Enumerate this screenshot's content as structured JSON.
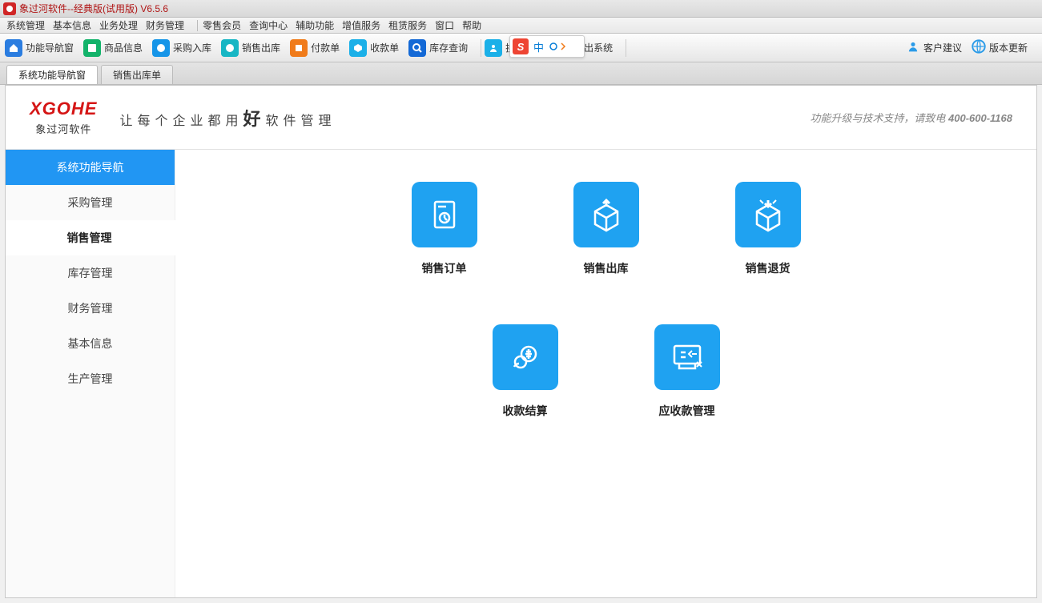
{
  "title": "象过河软件--经典版(试用版) V6.5.6",
  "menubar": [
    "系统管理",
    "基本信息",
    "业务处理",
    "财务管理",
    "零售会员",
    "查询中心",
    "辅助功能",
    "增值服务",
    "租赁服务",
    "窗口",
    "帮助"
  ],
  "toolbar": [
    {
      "label": "功能导航窗",
      "color": "#2b7de0"
    },
    {
      "label": "商品信息",
      "color": "#13b36a"
    },
    {
      "label": "采购入库",
      "color": "#1695e8"
    },
    {
      "label": "销售出库",
      "color": "#17b6c4"
    },
    {
      "label": "付款单",
      "color": "#f07b1a"
    },
    {
      "label": "收款单",
      "color": "#1bb0e8"
    },
    {
      "label": "库存查询",
      "color": "#1469d6"
    },
    {
      "label": "换操作员",
      "color": "#1bb0e8"
    },
    {
      "label": "退出系统",
      "color": "#e23a2e"
    }
  ],
  "toolbar_right": [
    {
      "label": "客户建议"
    },
    {
      "label": "版本更新"
    }
  ],
  "ime": {
    "zh": "中"
  },
  "tabs": [
    {
      "label": "系统功能导航窗",
      "active": true
    },
    {
      "label": "销售出库单",
      "active": false
    }
  ],
  "logo": {
    "big": "XGOHE",
    "small": "象过河软件"
  },
  "slogan_pre": "让每个企业都用",
  "slogan_hao": "好",
  "slogan_post": "软件管理",
  "banner_right_text": "功能升级与技术支持，请致电 ",
  "banner_right_phone": "400-600-1168",
  "sidebar": {
    "head": "系统功能导航",
    "items": [
      {
        "label": "采购管理",
        "active": false
      },
      {
        "label": "销售管理",
        "active": true
      },
      {
        "label": "库存管理",
        "active": false
      },
      {
        "label": "财务管理",
        "active": false
      },
      {
        "label": "基本信息",
        "active": false
      },
      {
        "label": "生产管理",
        "active": false
      }
    ]
  },
  "cards_row1": [
    {
      "label": "销售订单",
      "icon": "doc"
    },
    {
      "label": "销售出库",
      "icon": "box-up"
    },
    {
      "label": "销售退货",
      "icon": "box-down"
    }
  ],
  "cards_row2": [
    {
      "label": "收款结算",
      "icon": "coins"
    },
    {
      "label": "应收款管理",
      "icon": "receivable"
    }
  ]
}
